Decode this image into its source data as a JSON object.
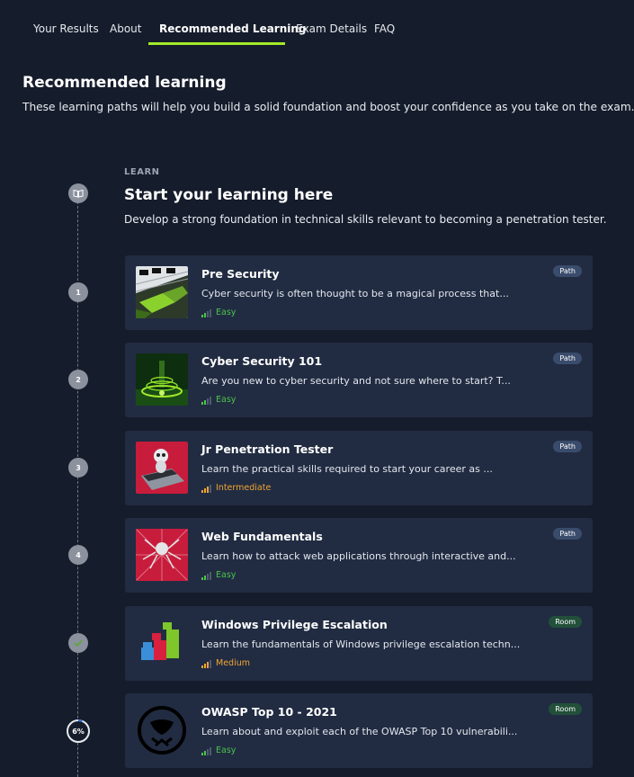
{
  "tabs": [
    {
      "label": "Your Results"
    },
    {
      "label": "About"
    },
    {
      "label": "Recommended Learning"
    },
    {
      "label": "Exam Details"
    },
    {
      "label": "FAQ"
    }
  ],
  "header": {
    "title": "Recommended learning",
    "subtitle": "These learning paths will help you build a solid foundation and boost your confidence as you take on the exam."
  },
  "section": {
    "kicker": "LEARN",
    "title": "Start your learning here",
    "description": "Develop a strong foundation in technical skills relevant to becoming a penetration tester."
  },
  "colors": {
    "accent": "#a3ea2a",
    "easy": "#4cc34c",
    "intermediate": "#f2a432",
    "medium": "#f2a432"
  },
  "cards": [
    {
      "step": "1",
      "title": "Pre Security",
      "desc": "Cyber security is often thought to be a magical process that...",
      "difficulty": "Easy",
      "badge": "Path",
      "badge_type": "path",
      "thumb": "pre-security-thumbnail"
    },
    {
      "step": "2",
      "title": "Cyber Security 101",
      "desc": "Are you new to cyber security and not sure where to start? T...",
      "difficulty": "Easy",
      "badge": "Path",
      "badge_type": "path",
      "thumb": "cyber-security-101-thumbnail"
    },
    {
      "step": "3",
      "title": "Jr Penetration Tester",
      "desc": "Learn the practical skills required to start your career as ...",
      "difficulty": "Intermediate",
      "badge": "Path",
      "badge_type": "path",
      "thumb": "jr-pentester-thumbnail"
    },
    {
      "step": "4",
      "title": "Web Fundamentals",
      "desc": "Learn how to attack web applications through interactive and...",
      "difficulty": "Easy",
      "badge": "Path",
      "badge_type": "path",
      "thumb": "web-fundamentals-thumbnail"
    },
    {
      "step": "",
      "title": "Windows Privilege Escalation",
      "desc": "Learn the fundamentals of Windows privilege escalation techn...",
      "difficulty": "Medium",
      "badge": "Room",
      "badge_type": "room",
      "thumb": "windows-privesc-thumbnail"
    },
    {
      "step": "6%",
      "title": "OWASP Top 10 - 2021",
      "desc": "Learn about and exploit each of the OWASP Top 10 vulnerabili...",
      "difficulty": "Easy",
      "badge": "Room",
      "badge_type": "room",
      "thumb": "owasp-thumbnail",
      "progress": 0.06
    }
  ]
}
